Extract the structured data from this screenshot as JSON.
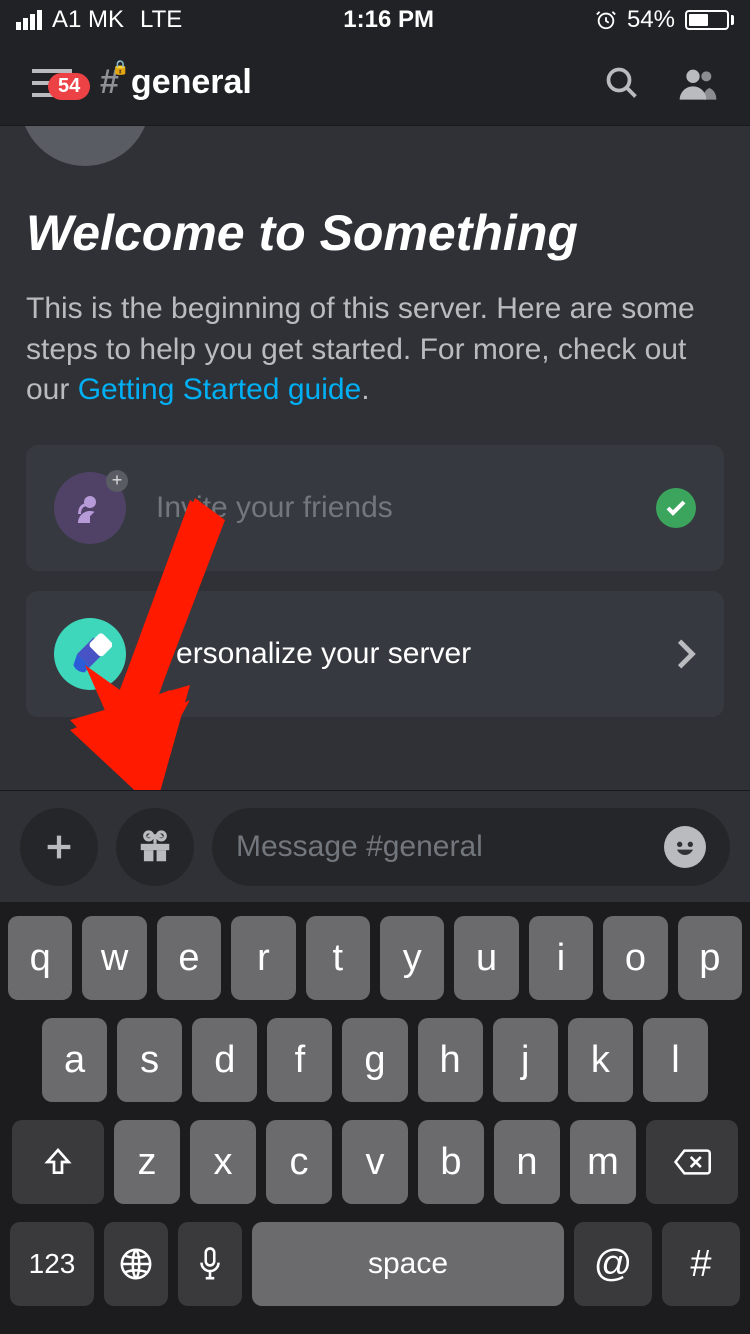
{
  "status_bar": {
    "carrier": "A1 MK",
    "network": "LTE",
    "time": "1:16 PM",
    "battery_pct": "54%"
  },
  "app_bar": {
    "badge": "54",
    "channel": "general"
  },
  "welcome": {
    "title": "Welcome to Something",
    "intro_a": "This is the beginning of this server. Here are some steps to help you get started. For more, check out our ",
    "link_text": "Getting Started guide",
    "intro_b": "."
  },
  "cards": {
    "invite": "Invite your friends",
    "personalize": "Personalize your server"
  },
  "composer": {
    "placeholder": "Message #general"
  },
  "keyboard": {
    "row1": [
      "q",
      "w",
      "e",
      "r",
      "t",
      "y",
      "u",
      "i",
      "o",
      "p"
    ],
    "row2": [
      "a",
      "s",
      "d",
      "f",
      "g",
      "h",
      "j",
      "k",
      "l"
    ],
    "row3": [
      "z",
      "x",
      "c",
      "v",
      "b",
      "n",
      "m"
    ],
    "numbers": "123",
    "space": "space",
    "at": "@",
    "hash": "#"
  }
}
